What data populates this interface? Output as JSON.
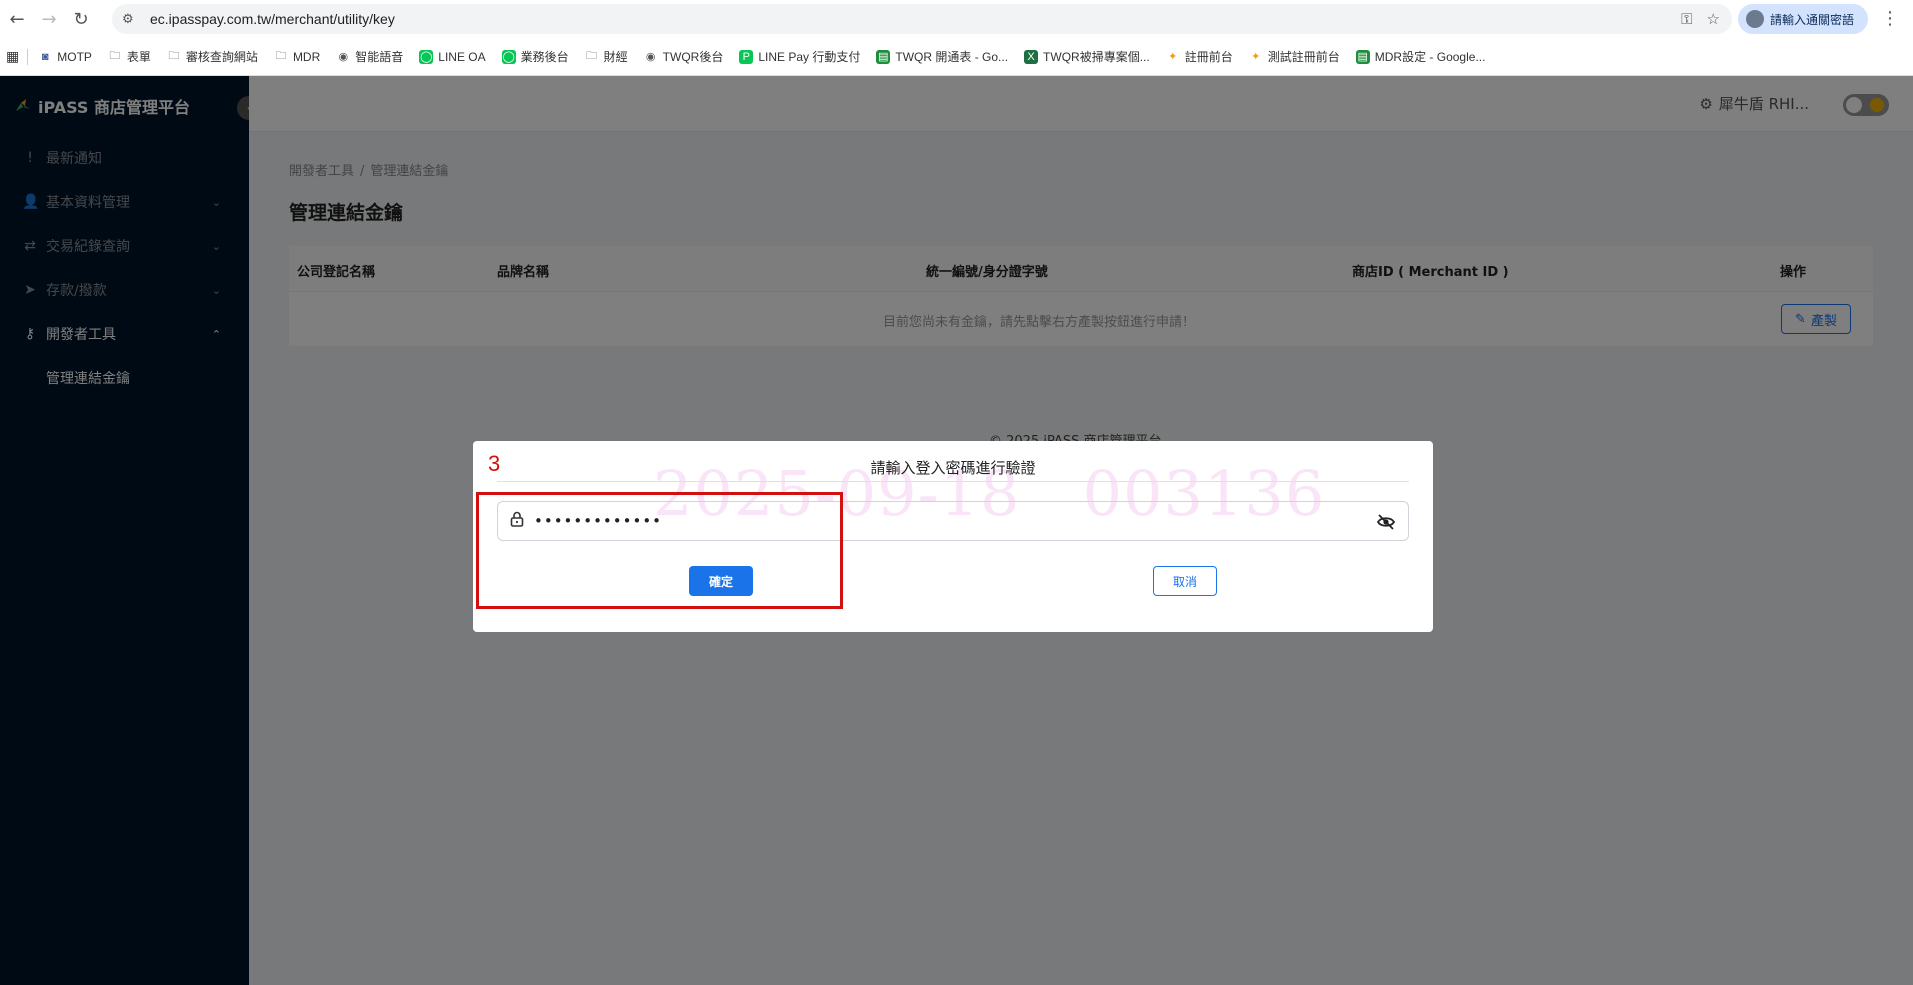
{
  "browser": {
    "url": "ec.ipasspay.com.tw/merchant/utility/key",
    "profile_label": "請輸入通關密語",
    "bookmarks": [
      {
        "label": "MOTP",
        "icon": "robot-icon"
      },
      {
        "label": "表單",
        "icon": "folder-icon"
      },
      {
        "label": "審核查詢網站",
        "icon": "folder-icon"
      },
      {
        "label": "MDR",
        "icon": "folder-icon"
      },
      {
        "label": "智能語音",
        "icon": "globe-icon"
      },
      {
        "label": "LINE OA",
        "icon": "line-icon"
      },
      {
        "label": "業務後台",
        "icon": "line-icon"
      },
      {
        "label": "財經",
        "icon": "folder-icon"
      },
      {
        "label": "TWQR後台",
        "icon": "globe-icon"
      },
      {
        "label": "LINE Pay 行動支付",
        "icon": "linepay-icon"
      },
      {
        "label": "TWQR 開通表 - Go...",
        "icon": "sheets-icon"
      },
      {
        "label": "TWQR被掃專案個...",
        "icon": "excel-icon"
      },
      {
        "label": "註冊前台",
        "icon": "ipass-icon"
      },
      {
        "label": "測試註冊前台",
        "icon": "ipass-icon"
      },
      {
        "label": "MDR設定 - Google...",
        "icon": "sheets-icon"
      }
    ]
  },
  "sidebar": {
    "brand": "iPASS 商店管理平台",
    "items": [
      {
        "label": "最新通知",
        "icon": "!"
      },
      {
        "label": "基本資料管理",
        "icon": "👤"
      },
      {
        "label": "交易紀錄查詢",
        "icon": "⇄"
      },
      {
        "label": "存款/撥款",
        "icon": "➤"
      },
      {
        "label": "開發者工具",
        "icon": "⚷"
      }
    ],
    "submenu": {
      "label": "管理連結金鑰"
    }
  },
  "header": {
    "user": "犀牛盾 RHI..."
  },
  "page": {
    "breadcrumb": [
      "開發者工具",
      "管理連結金鑰"
    ],
    "title": "管理連結金鑰",
    "columns": [
      "公司登記名稱",
      "品牌名稱",
      "統一編號/身分證字號",
      "商店ID ( Merchant ID )",
      "操作"
    ],
    "empty_message": "目前您尚未有金鑰，請先點擊右方產製按鈕進行申請！",
    "generate_label": "產製",
    "footer": "2025 iPASS 商店管理平台"
  },
  "dialog": {
    "title": "請輸入登入密碼進行驗證",
    "watermark": "2025-09-18   003136",
    "password_value": "•••••••••••••",
    "ok_label": "確定",
    "cancel_label": "取消"
  },
  "annotation": {
    "number": "3",
    "color": "#d21010"
  },
  "colors": {
    "sidebar_bg": "#001529",
    "primary": "#1a73e8"
  }
}
